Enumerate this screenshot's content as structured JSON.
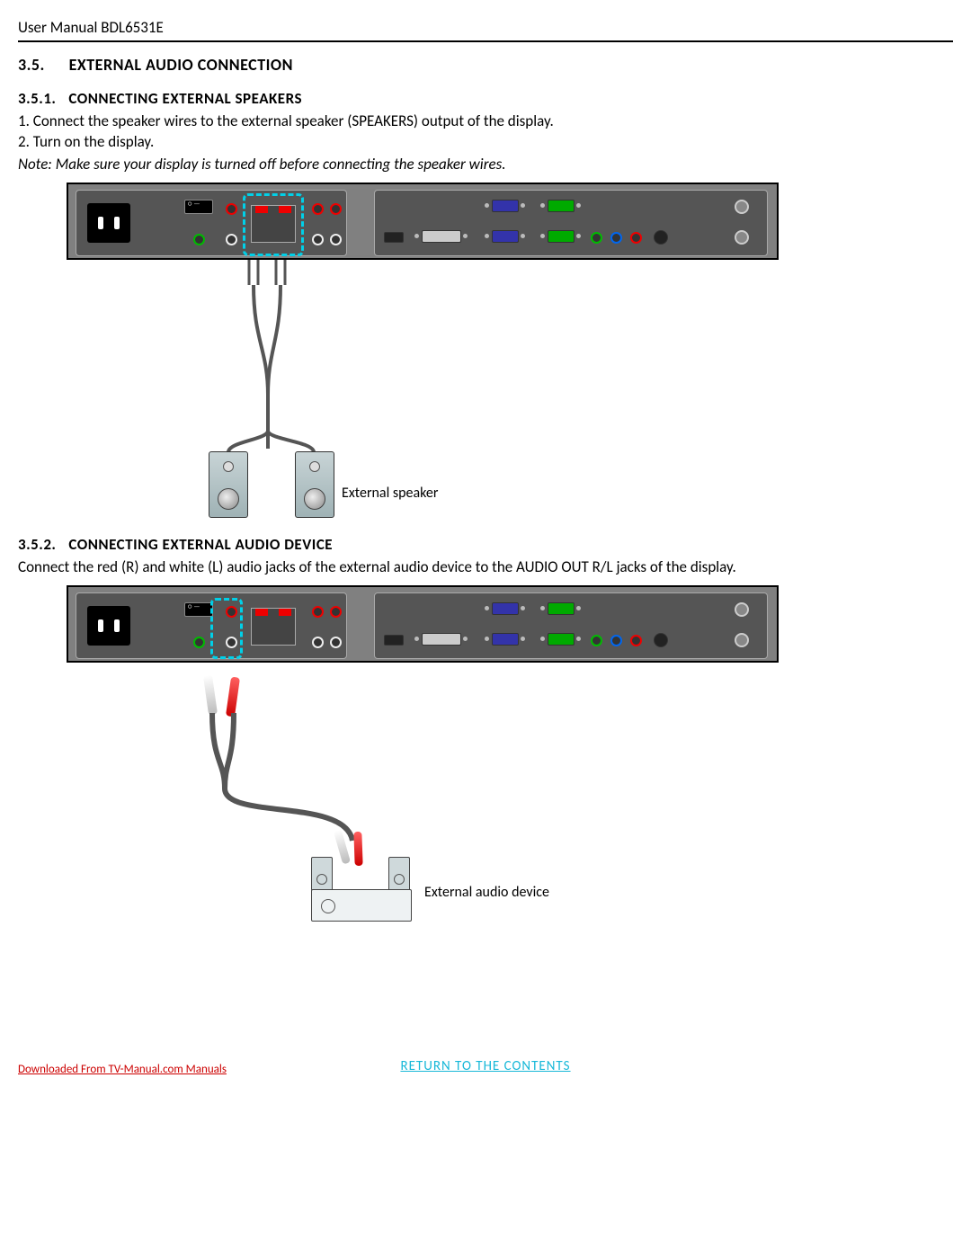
{
  "header": {
    "manual_title": "User Manual BDL6531E"
  },
  "section_35": {
    "number": "3.5.",
    "title": "EXTERNAL AUDIO CONNECTION"
  },
  "section_351": {
    "number": "3.5.1.",
    "title": "CONNECTING EXTERNAL SPEAKERS",
    "step1": "1. Connect the speaker wires to the external speaker (SPEAKERS) output of the display.",
    "step2": "2. Turn on the display.",
    "note": "Note: Make sure your display is turned off before connecting the speaker wires.",
    "label_external_speaker": "External speaker"
  },
  "section_352": {
    "number": "3.5.2.",
    "title": "CONNECTING EXTERNAL AUDIO DEVICE",
    "body": "Connect the red (R) and white (L) audio jacks of the external audio device to the AUDIO OUT R/L jacks of the display.",
    "label_external_audio_device": "External audio device"
  },
  "footer": {
    "download_link": "Downloaded From TV-Manual.com Manuals",
    "return_link": "RETURN TO THE CONTENTS"
  }
}
